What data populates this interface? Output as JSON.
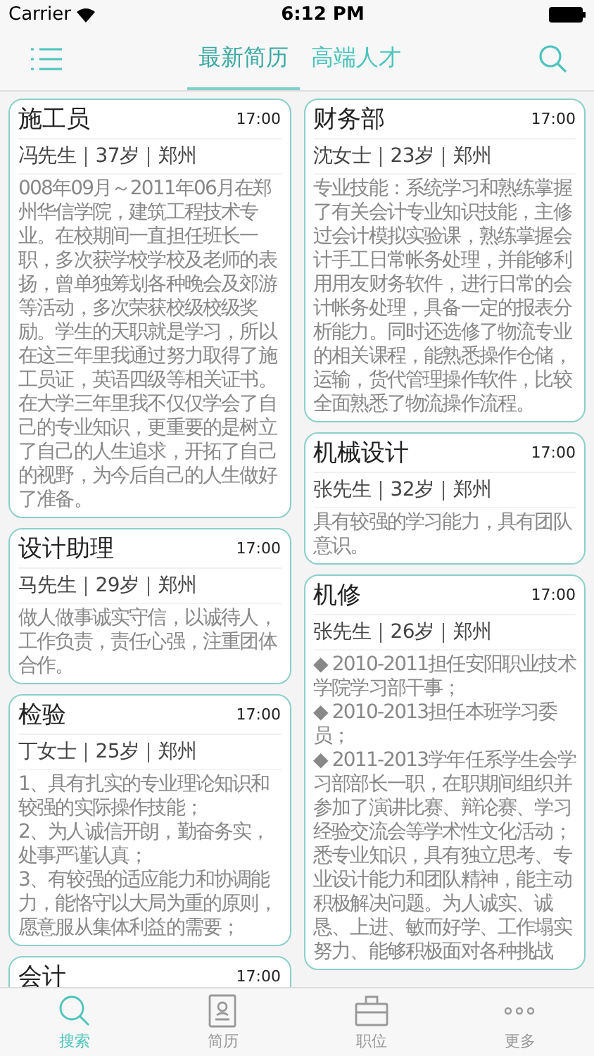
{
  "status_bar": {
    "carrier": "Carrier",
    "time": "6:12 PM"
  },
  "nav": {
    "tabs": [
      {
        "label": "最新简历",
        "selected": true
      },
      {
        "label": "高端人才",
        "selected": false
      }
    ]
  },
  "columns": [
    [
      {
        "title": "施工员",
        "time": "17:00",
        "meta": "冯先生｜37岁｜郑州",
        "body": "008年09月～2011年06月在郑州华信学院，建筑工程技术专业。在校期间一直担任班长一职，多次获学校学校及老师的表扬，曾单独筹划各种晚会及郊游等活动，多次荣获校级校级奖励。学生的天职就是学习，所以在这三年里我通过努力取得了施工员证，英语四级等相关证书。在大学三年里我不仅仅学会了自己的专业知识，更重要的是树立了自己的人生追求，开拓了自己的视野，为今后自己的人生做好了准备。"
      },
      {
        "title": "设计助理",
        "time": "17:00",
        "meta": "马先生｜29岁｜郑州",
        "body": "做人做事诚实守信，以诚待人，工作负责，责任心强，注重团体合作。"
      },
      {
        "title": "检验",
        "time": "17:00",
        "meta": "丁女士｜25岁｜郑州",
        "body": [
          "1、具有扎实的专业理论知识和较强的实际操作技能；",
          "2、为人诚信开朗，勤奋务实，处事严谨认真；",
          "3、有较强的适应能力和协调能力，能恪守以大局为重的原则，愿意服从集体利益的需要；"
        ]
      },
      {
        "title": "会计",
        "time": "17:00"
      }
    ],
    [
      {
        "title": "财务部",
        "time": "17:00",
        "meta": "沈女士｜23岁｜郑州",
        "body": "专业技能：系统学习和熟练掌握了有关会计专业知识技能，主修过会计模拟实验课，熟练掌握会计手工日常帐务处理，并能够利用用友财务软件，进行日常的会计帐务处理，具备一定的报表分析能力。同时还选修了物流专业的相关课程，能熟悉操作仓储，运输，货代管理操作软件，比较全面熟悉了物流操作流程。"
      },
      {
        "title": "机械设计",
        "time": "17:00",
        "meta": "张先生｜32岁｜郑州",
        "body": "具有较强的学习能力，具有团队意识。"
      },
      {
        "title": "机修",
        "time": "17:00",
        "meta": "张先生｜26岁｜郑州",
        "body": [
          "◆ 2010-2011担任安阳职业技术学院学习部干事；",
          "◆ 2010-2013担任本班学习委员；",
          "◆  2011-2013学年任系学生会学习部部长一职，在职期间组织并参加了演讲比赛、辩论赛、学习经验交流会等学术性文化活动；",
          "悉专业知识，具有独立思考、专业设计能力和团队精神，能主动积极解决问题。为人诚实、诚恳、上进、敏而好学、工作塌实努力、能够积极面对各种挑战"
        ]
      }
    ]
  ],
  "tab_bar": [
    {
      "kind": "search",
      "label": "搜索",
      "selected": true
    },
    {
      "kind": "resume",
      "label": "简历",
      "selected": false
    },
    {
      "kind": "job",
      "label": "职位",
      "selected": false
    },
    {
      "kind": "more",
      "label": "更多",
      "selected": false
    }
  ]
}
